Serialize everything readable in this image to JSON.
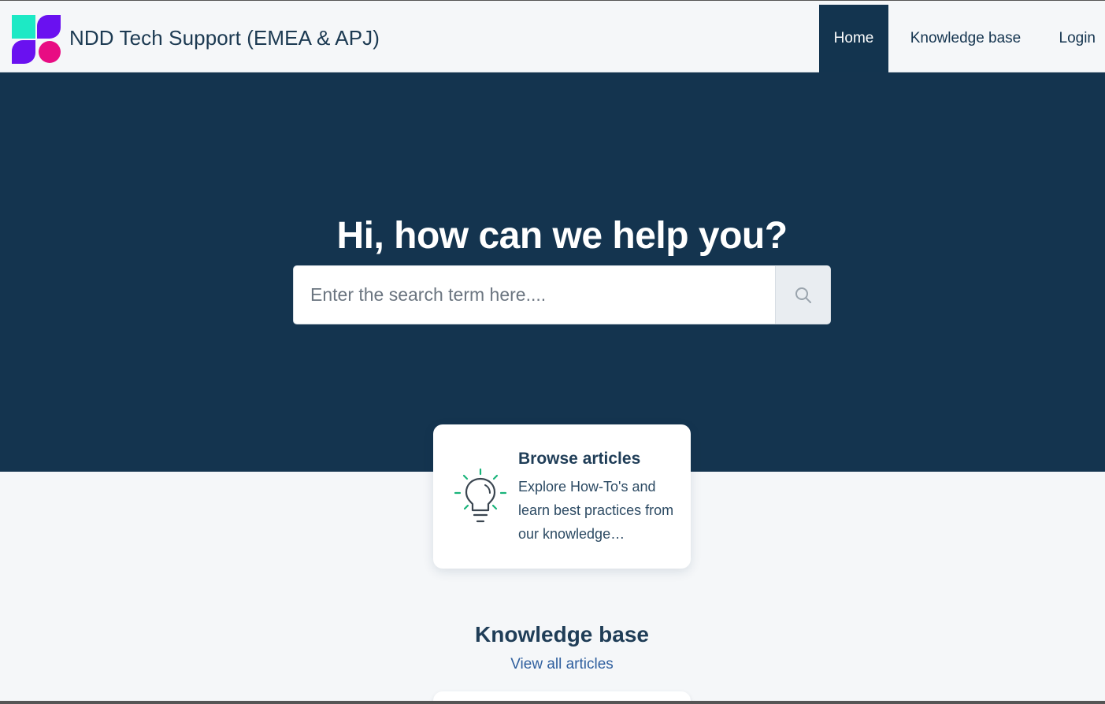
{
  "header": {
    "title": "NDD Tech Support (EMEA & APJ)",
    "nav": {
      "home": "Home",
      "knowledge_base": "Knowledge base",
      "login": "Login"
    }
  },
  "hero": {
    "title": "Hi, how can we help you?",
    "search": {
      "placeholder": "Enter the search term here....",
      "value": ""
    }
  },
  "cards": [
    {
      "title": "Browse articles",
      "description": "Explore How-To's and learn best practices from our knowledge…",
      "icon": "lightbulb-icon"
    }
  ],
  "knowledge_base": {
    "heading": "Knowledge base",
    "view_all": "View all articles"
  },
  "colors": {
    "header_bg": "#f5f7f9",
    "hero_bg": "#14344f",
    "nav_active_bg": "#13344f",
    "link": "#2f5f9e",
    "logo_teal": "#1de9c5",
    "logo_purple": "#6a11f0",
    "logo_magenta": "#e80c83",
    "icon_green": "#19b47a"
  }
}
